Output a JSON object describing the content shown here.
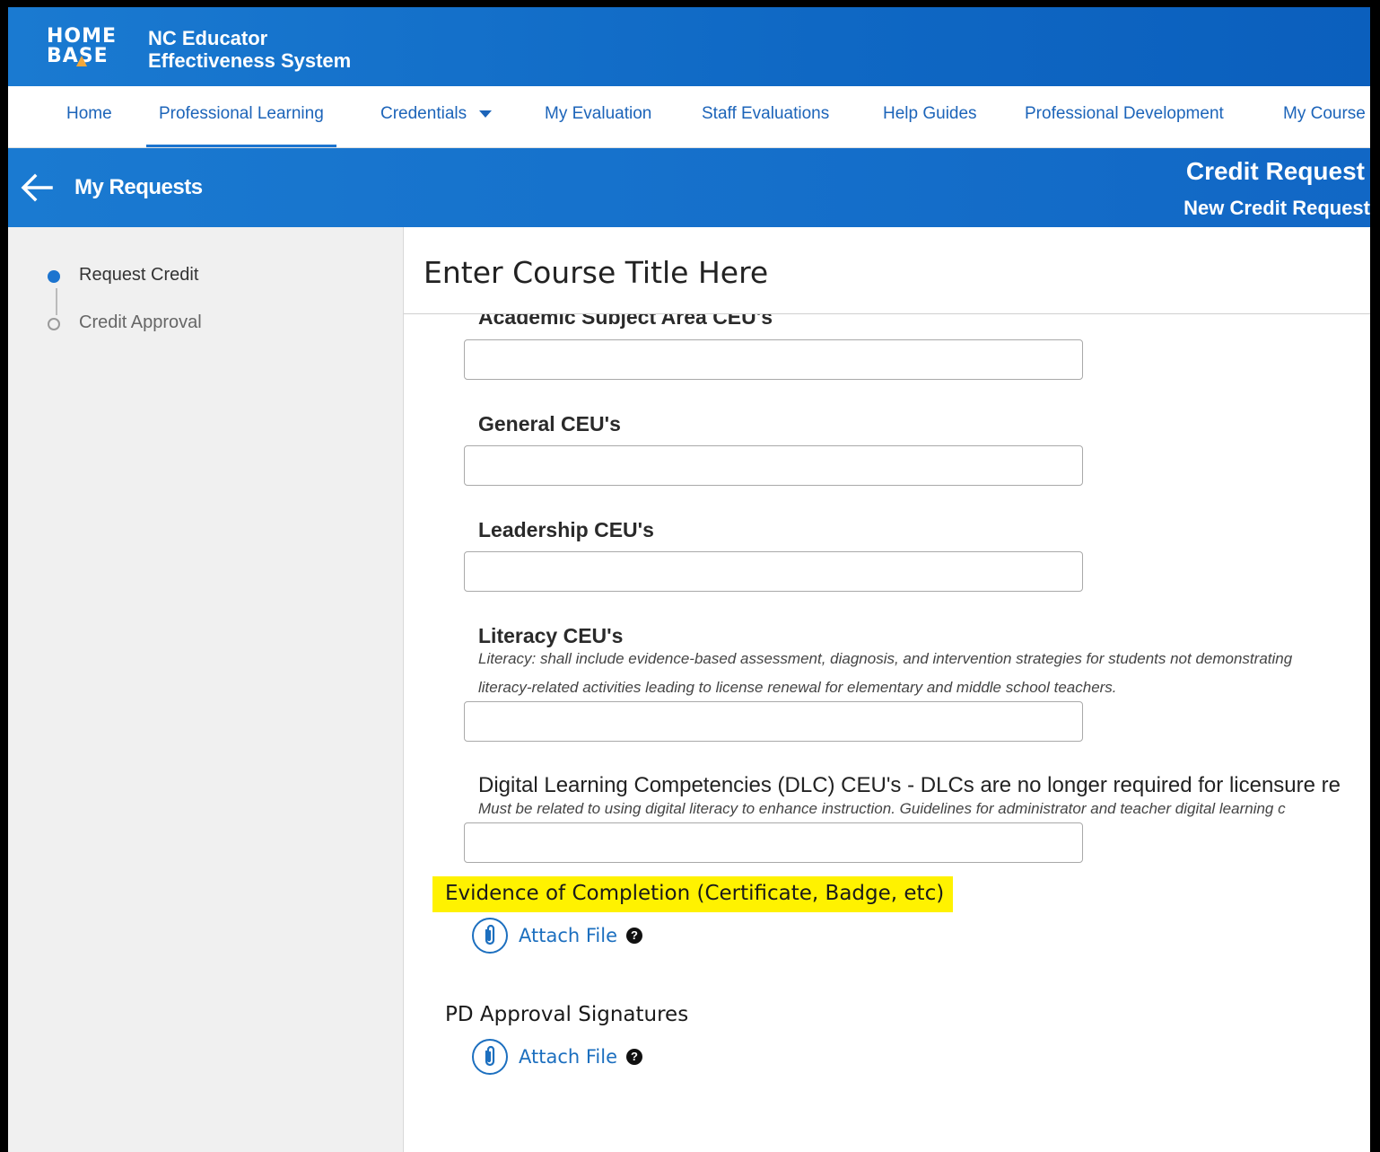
{
  "brand": {
    "logo_line1": "HOME",
    "logo_line2": "BASE",
    "title_line1": "NC Educator",
    "title_line2": "Effectiveness System"
  },
  "nav": {
    "items": [
      {
        "label": "Home"
      },
      {
        "label": "Professional Learning"
      },
      {
        "label": "Credentials"
      },
      {
        "label": "My Evaluation"
      },
      {
        "label": "Staff Evaluations"
      },
      {
        "label": "Help Guides"
      },
      {
        "label": "Professional Development"
      },
      {
        "label": "My Course"
      }
    ],
    "active": "Professional Learning"
  },
  "header": {
    "back_label": "My Requests",
    "title": "Credit Request",
    "subtitle": "New Credit Request"
  },
  "steps": [
    {
      "label": "Request Credit",
      "status": "current"
    },
    {
      "label": "Credit Approval",
      "status": "pending"
    }
  ],
  "main": {
    "course_title": "Enter Course Title Here",
    "fields": [
      {
        "label": "Academic Subject Area CEU's",
        "value": ""
      },
      {
        "label": "General CEU's",
        "value": ""
      },
      {
        "label": "Leadership CEU's",
        "value": ""
      },
      {
        "label": "Literacy CEU's",
        "help1": "Literacy: shall include evidence-based assessment, diagnosis, and intervention strategies for students not demonstrating",
        "help2": "literacy-related activities leading to license renewal for elementary and middle school teachers.",
        "value": ""
      },
      {
        "label": "Digital Learning Competencies (DLC) CEU's - DLCs are no longer required for licensure re",
        "help1": "Must be related to using digital literacy to enhance instruction. Guidelines for administrator and teacher digital learning c",
        "value": ""
      }
    ],
    "evidence": {
      "label": "Evidence of Completion (Certificate, Badge, etc)",
      "attach_label": "Attach File"
    },
    "signatures": {
      "label": "PD Approval Signatures",
      "attach_label": "Attach File"
    }
  },
  "colors": {
    "brand_blue": "#1167c5",
    "link_blue": "#1c64b9",
    "highlight": "#fff200"
  }
}
